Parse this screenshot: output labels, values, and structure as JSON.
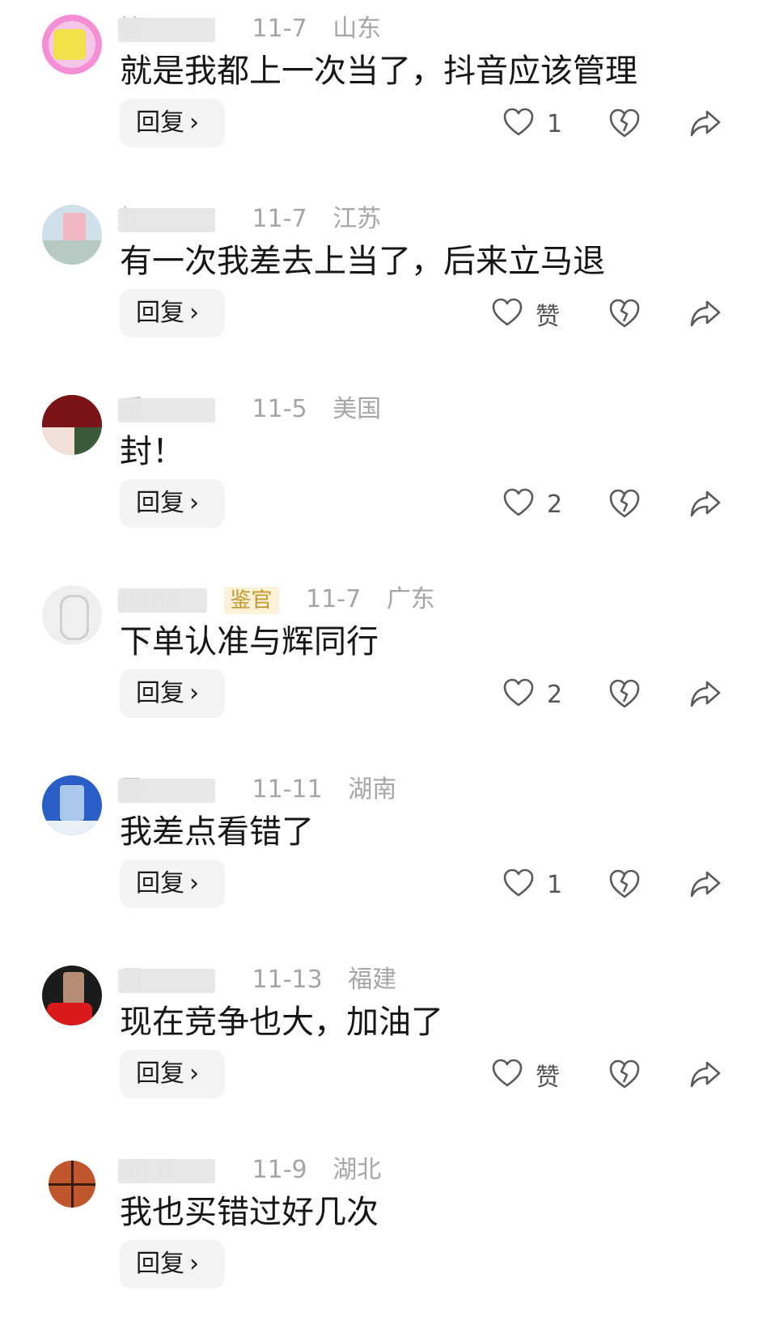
{
  "reply_label": "回复",
  "reply_chevron": "›",
  "colors": {
    "accent_badge": "#c49a2c",
    "meta_gray": "#a6a6a6",
    "reply_bg": "#f4f4f4"
  },
  "comments": [
    {
      "name": "管",
      "badge": "",
      "date": "11-7",
      "location": "山东",
      "text": "就是我都上一次当了，抖音应该管理",
      "likes": "1",
      "avatar_icon": "avatar-pink"
    },
    {
      "name": "钅",
      "badge": "",
      "date": "11-7",
      "location": "江苏",
      "text": "有一次我差去上当了，后来立马退",
      "likes": "赞",
      "avatar_icon": "avatar-photo"
    },
    {
      "name": "乐",
      "badge": "",
      "date": "11-5",
      "location": "美国",
      "text": "封！",
      "likes": "2",
      "avatar_icon": "avatar-red"
    },
    {
      "name": "papa",
      "badge": "鉴官",
      "date": "11-7",
      "location": "广东",
      "text": "下单认准与辉同行",
      "likes": "2",
      "avatar_icon": "avatar-white"
    },
    {
      "name": "录",
      "badge": "",
      "date": "11-11",
      "location": "湖南",
      "text": "我差点看错了",
      "likes": "1",
      "avatar_icon": "avatar-sky"
    },
    {
      "name": "日",
      "badge": "",
      "date": "11-13",
      "location": "福建",
      "text": "现在竞争也大，加油了",
      "likes": "赞",
      "avatar_icon": "avatar-dark"
    },
    {
      "name": "og d",
      "badge": "",
      "date": "11-9",
      "location": "湖北",
      "text": "我也买错过好几次",
      "likes": "",
      "avatar_icon": "avatar-ball"
    }
  ]
}
